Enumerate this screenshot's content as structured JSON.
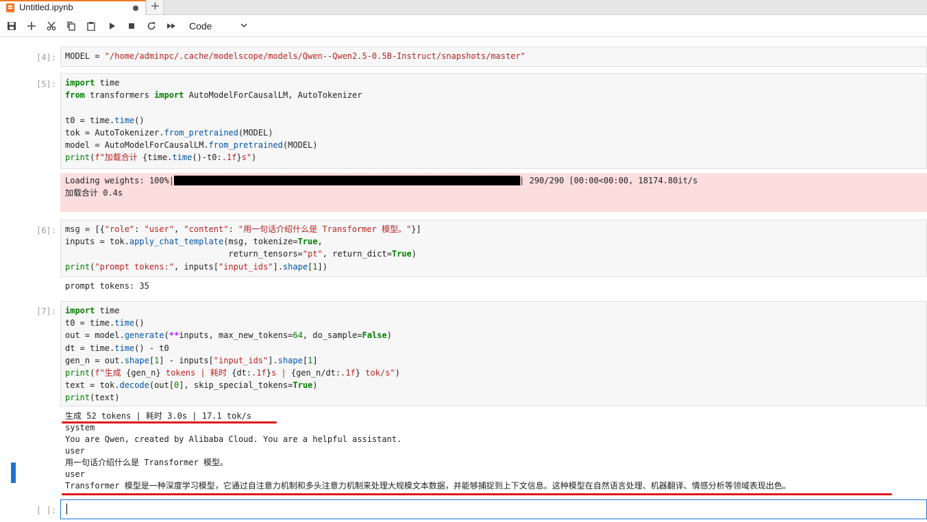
{
  "tab": {
    "title": "Untitled.ipynb"
  },
  "toolbar": {
    "cell_type": "Code"
  },
  "cells": [
    {
      "prompt": "[4]:",
      "code": [
        "MODEL = \"/home/adminpc/.cache/modelscope/models/Qwen--Qwen2.5-0.5B-Instruct/snapshots/master\""
      ]
    },
    {
      "prompt": "[5]:",
      "code": [
        "import time",
        "from transformers import AutoModelForCausalLM, AutoTokenizer",
        "",
        "t0 = time.time()",
        "tok = AutoTokenizer.from_pretrained(MODEL)",
        "model = AutoModelForCausalLM.from_pretrained(MODEL)",
        "print(f\"加载合计 {time.time()-t0:.1f}s\")"
      ],
      "stderr": {
        "label": "Loading weights: 100%|",
        "progress": 1.0,
        "stats": "| 290/290 [00:00<00:00, 18174.80it/s"
      },
      "output": [
        "加载合计 0.4s"
      ]
    },
    {
      "prompt": "[6]:",
      "code": [
        "msg = [{\"role\": \"user\", \"content\": \"用一句话介绍什么是 Transformer 模型。\"}]",
        "inputs = tok.apply_chat_template(msg, tokenize=True,",
        "                                 return_tensors=\"pt\", return_dict=True)",
        "print(\"prompt tokens:\", inputs[\"input_ids\"].shape[1])"
      ],
      "output": [
        "prompt tokens: 35"
      ]
    },
    {
      "prompt": "[7]:",
      "code": [
        "import time",
        "t0 = time.time()",
        "out = model.generate(**inputs, max_new_tokens=64, do_sample=False)",
        "dt = time.time() - t0",
        "gen_n = out.shape[1] - inputs[\"input_ids\"].shape[1]",
        "print(f\"生成 {gen_n} tokens | 耗时 {dt:.1f}s | {gen_n/dt:.1f} tok/s\")",
        "text = tok.decode(out[0], skip_special_tokens=True)",
        "print(text)"
      ],
      "output": [
        "生成 52 tokens | 耗时 3.0s | 17.1 tok/s",
        "system",
        "You are Qwen, created by Alibaba Cloud. You are a helpful assistant.",
        "user",
        "用一句话介绍什么是 Transformer 模型。",
        "user",
        "Transformer 模型是一种深度学习模型，它通过自注意力机制和多头注意力机制来处理大规模文本数据，并能够捕捉到上下文信息。这种模型在自然语言处理、机器翻译、情感分析等领域表现出色。"
      ]
    }
  ],
  "empty_prompt": "[ ]:",
  "colors": {
    "keyword": "#008000",
    "string": "#ba2121",
    "annotation_underline": "#e1141b",
    "active_cell": "#1976d2",
    "stderr_bg": "#fddede"
  }
}
